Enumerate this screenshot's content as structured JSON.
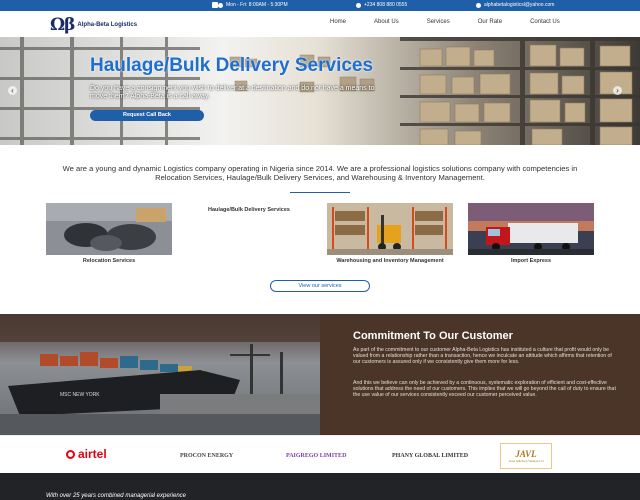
{
  "topbar": {
    "hours": "Mon - Fri: 8:00AM - 5:30PM",
    "phone": "+234 808 880 0555",
    "email": "alphabetalogisticsl@yahoo.com"
  },
  "header": {
    "logo_symbol": "Ωβ",
    "logo_name": "Alpha-Beta Logistics",
    "nav": [
      "Home",
      "About Us",
      "Services",
      "Our Rate",
      "Contact Us"
    ]
  },
  "hero": {
    "title": "Haulage/Bulk Delivery Services",
    "text": "Do you have a consignment you wish to deliver at a destination and do not have a means to move them? Alpha-Beta is a call away.",
    "button": "Request Call Back",
    "prev": "‹",
    "next": "›"
  },
  "intro": {
    "text": "We are a young and dynamic Logistics company operating in Nigeria since 2014. We are a professional logistics solutions company with competencies in Relocation Services, Haulage/Bulk Delivery Services, and Warehousing & Inventory Management."
  },
  "services": {
    "items": [
      {
        "label": "Relocation Services"
      },
      {
        "label": "Haulage/Bulk Delivery Services"
      },
      {
        "label": "Warehousing and Inventory Management"
      },
      {
        "label": "Import Express"
      }
    ],
    "view_button": "View our services"
  },
  "commitment": {
    "title": "Commitment To Our Customer",
    "paragraphs": [
      "As part of the commitment to our customer Alpha-Beta Logistics has instituted a culture that profit would only be valued from a relationship rather than a transaction, hence we inculcate an attitude which affirms that retention of our customers is assured only if we consistently give them more for less.",
      "And this we believe can only be achieved by a continuous, systematic exploration of efficient and cost-effective solutions that address the need of our customers. This implies that we will go beyond the call of duty to ensure that the use value of our services consistently exceed our customer perceived value."
    ],
    "ship_name": "MSC NEW YORK"
  },
  "partners": {
    "airtel": "airtel",
    "procon": "PROCON ENERGY",
    "paigrego": "PAIGREGO LIMITED",
    "phany": "PHANY GLOBAL LIMITED",
    "javl": "JAVL",
    "javl_sub": "Jonas Adfabson Ventures Ltd"
  },
  "footer": {
    "text": "With over 25 years combined managerial experience"
  },
  "colors": {
    "primary": "#1f5fa8",
    "brown_panel": "#4a3528",
    "footer": "#222326",
    "airtel_red": "#e60012"
  }
}
